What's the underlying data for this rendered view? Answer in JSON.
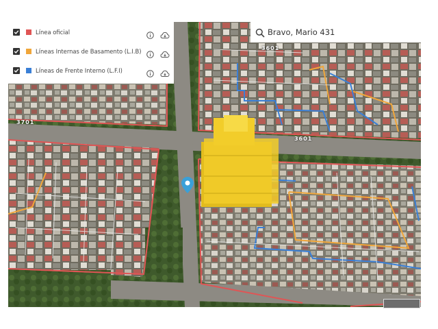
{
  "layers_panel": {
    "items": [
      {
        "label": "Línea oficial",
        "color": "#e05555",
        "checked": true,
        "info_icon": "info-icon",
        "download_icon": "cloud-download-icon"
      },
      {
        "label": "Líneas Internas de Basamento (L.I.B)",
        "color": "#f0a63a",
        "checked": true,
        "info_icon": "info-icon",
        "download_icon": "cloud-download-icon"
      },
      {
        "label": "Líneas de Frente Interno (L.F.I)",
        "color": "#3a7fd6",
        "checked": true,
        "info_icon": "info-icon",
        "download_icon": "cloud-download-icon"
      }
    ]
  },
  "search": {
    "value": "Bravo, Mario 431",
    "icon": "search-icon"
  },
  "map": {
    "street_labels": [
      "3601",
      "3601",
      "3701"
    ],
    "building_color": "#f2cd2a",
    "marker_icon": "location-pin-icon",
    "colors": {
      "linea_oficial": "#e05555",
      "lib": "#f0a63a",
      "lfi": "#3a7fd6"
    }
  }
}
